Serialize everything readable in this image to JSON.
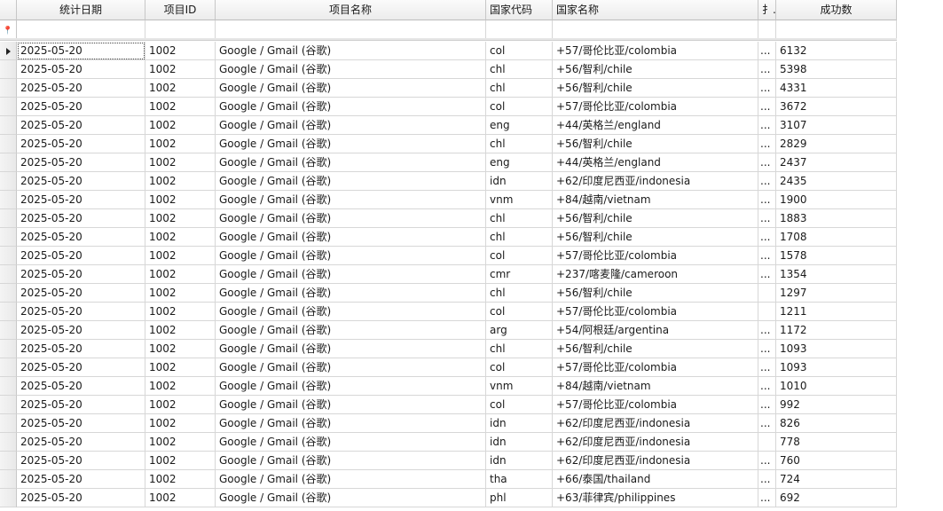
{
  "columns": {
    "date": "统计日期",
    "project_id": "项目ID",
    "project_name": "项目名称",
    "country_code": "国家代码",
    "country_name": "国家名称",
    "truncated": "扌..",
    "success_count": "成功数"
  },
  "icons": {
    "current_row": "current-row-triangle-icon",
    "filter": "filter-pin-icon"
  },
  "rows": [
    {
      "date": "2025-05-20",
      "project_id": "1002",
      "project_name": "Google / Gmail (谷歌)",
      "country_code": "col",
      "country_name": "+57/哥伦比亚/colombia",
      "extra": "...",
      "success_count": "6132"
    },
    {
      "date": "2025-05-20",
      "project_id": "1002",
      "project_name": "Google / Gmail (谷歌)",
      "country_code": "chl",
      "country_name": "+56/智利/chile",
      "extra": "...",
      "success_count": "5398"
    },
    {
      "date": "2025-05-20",
      "project_id": "1002",
      "project_name": "Google / Gmail (谷歌)",
      "country_code": "chl",
      "country_name": "+56/智利/chile",
      "extra": "...",
      "success_count": "4331"
    },
    {
      "date": "2025-05-20",
      "project_id": "1002",
      "project_name": "Google / Gmail (谷歌)",
      "country_code": "col",
      "country_name": "+57/哥伦比亚/colombia",
      "extra": "...",
      "success_count": "3672"
    },
    {
      "date": "2025-05-20",
      "project_id": "1002",
      "project_name": "Google / Gmail (谷歌)",
      "country_code": "eng",
      "country_name": "+44/英格兰/england",
      "extra": "...",
      "success_count": "3107"
    },
    {
      "date": "2025-05-20",
      "project_id": "1002",
      "project_name": "Google / Gmail (谷歌)",
      "country_code": "chl",
      "country_name": "+56/智利/chile",
      "extra": "...",
      "success_count": "2829"
    },
    {
      "date": "2025-05-20",
      "project_id": "1002",
      "project_name": "Google / Gmail (谷歌)",
      "country_code": "eng",
      "country_name": "+44/英格兰/england",
      "extra": "...",
      "success_count": "2437"
    },
    {
      "date": "2025-05-20",
      "project_id": "1002",
      "project_name": "Google / Gmail (谷歌)",
      "country_code": "idn",
      "country_name": "+62/印度尼西亚/indonesia",
      "extra": "...",
      "success_count": "2435"
    },
    {
      "date": "2025-05-20",
      "project_id": "1002",
      "project_name": "Google / Gmail (谷歌)",
      "country_code": "vnm",
      "country_name": "+84/越南/vietnam",
      "extra": "...",
      "success_count": "1900"
    },
    {
      "date": "2025-05-20",
      "project_id": "1002",
      "project_name": "Google / Gmail (谷歌)",
      "country_code": "chl",
      "country_name": "+56/智利/chile",
      "extra": "...",
      "success_count": "1883"
    },
    {
      "date": "2025-05-20",
      "project_id": "1002",
      "project_name": "Google / Gmail (谷歌)",
      "country_code": "chl",
      "country_name": "+56/智利/chile",
      "extra": "...",
      "success_count": "1708"
    },
    {
      "date": "2025-05-20",
      "project_id": "1002",
      "project_name": "Google / Gmail (谷歌)",
      "country_code": "col",
      "country_name": "+57/哥伦比亚/colombia",
      "extra": "...",
      "success_count": "1578"
    },
    {
      "date": "2025-05-20",
      "project_id": "1002",
      "project_name": "Google / Gmail (谷歌)",
      "country_code": "cmr",
      "country_name": "+237/喀麦隆/cameroon",
      "extra": "...",
      "success_count": "1354"
    },
    {
      "date": "2025-05-20",
      "project_id": "1002",
      "project_name": "Google / Gmail (谷歌)",
      "country_code": "chl",
      "country_name": "+56/智利/chile",
      "extra": "",
      "success_count": "1297"
    },
    {
      "date": "2025-05-20",
      "project_id": "1002",
      "project_name": "Google / Gmail (谷歌)",
      "country_code": "col",
      "country_name": "+57/哥伦比亚/colombia",
      "extra": "",
      "success_count": "1211"
    },
    {
      "date": "2025-05-20",
      "project_id": "1002",
      "project_name": "Google / Gmail (谷歌)",
      "country_code": "arg",
      "country_name": "+54/阿根廷/argentina",
      "extra": "...",
      "success_count": "1172"
    },
    {
      "date": "2025-05-20",
      "project_id": "1002",
      "project_name": "Google / Gmail (谷歌)",
      "country_code": "chl",
      "country_name": "+56/智利/chile",
      "extra": "...",
      "success_count": "1093"
    },
    {
      "date": "2025-05-20",
      "project_id": "1002",
      "project_name": "Google / Gmail (谷歌)",
      "country_code": "col",
      "country_name": "+57/哥伦比亚/colombia",
      "extra": "...",
      "success_count": "1093"
    },
    {
      "date": "2025-05-20",
      "project_id": "1002",
      "project_name": "Google / Gmail (谷歌)",
      "country_code": "vnm",
      "country_name": "+84/越南/vietnam",
      "extra": "...",
      "success_count": "1010"
    },
    {
      "date": "2025-05-20",
      "project_id": "1002",
      "project_name": "Google / Gmail (谷歌)",
      "country_code": "col",
      "country_name": "+57/哥伦比亚/colombia",
      "extra": "...",
      "success_count": "992"
    },
    {
      "date": "2025-05-20",
      "project_id": "1002",
      "project_name": "Google / Gmail (谷歌)",
      "country_code": "idn",
      "country_name": "+62/印度尼西亚/indonesia",
      "extra": "...",
      "success_count": "826"
    },
    {
      "date": "2025-05-20",
      "project_id": "1002",
      "project_name": "Google / Gmail (谷歌)",
      "country_code": "idn",
      "country_name": "+62/印度尼西亚/indonesia",
      "extra": "",
      "success_count": "778"
    },
    {
      "date": "2025-05-20",
      "project_id": "1002",
      "project_name": "Google / Gmail (谷歌)",
      "country_code": "idn",
      "country_name": "+62/印度尼西亚/indonesia",
      "extra": "...",
      "success_count": "760"
    },
    {
      "date": "2025-05-20",
      "project_id": "1002",
      "project_name": "Google / Gmail (谷歌)",
      "country_code": "tha",
      "country_name": "+66/泰国/thailand",
      "extra": "...",
      "success_count": "724"
    },
    {
      "date": "2025-05-20",
      "project_id": "1002",
      "project_name": "Google / Gmail (谷歌)",
      "country_code": "phl",
      "country_name": "+63/菲律宾/philippines",
      "extra": "...",
      "success_count": "692"
    }
  ]
}
